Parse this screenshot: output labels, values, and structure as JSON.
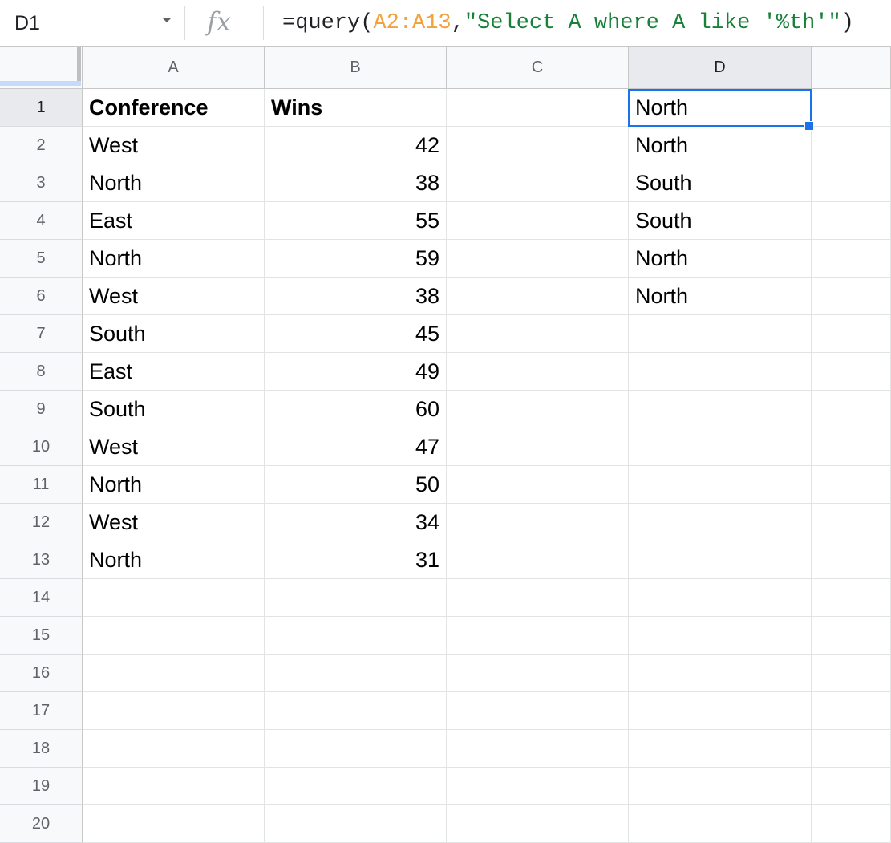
{
  "name_box": {
    "value": "D1"
  },
  "formula_bar": {
    "fx_label": "fx",
    "parts": [
      "=query(",
      "A2:A13",
      ",",
      "\"Select A where A like '%th'\"",
      ")"
    ]
  },
  "columns": [
    "A",
    "B",
    "C",
    "D"
  ],
  "selected_column": "D",
  "rows": [
    "1",
    "2",
    "3",
    "4",
    "5",
    "6",
    "7",
    "8",
    "9",
    "10",
    "11",
    "12",
    "13",
    "14",
    "15",
    "16",
    "17",
    "18",
    "19",
    "20"
  ],
  "selected_row": "1",
  "cells": {
    "A": [
      "Conference",
      "West",
      "North",
      "East",
      "North",
      "West",
      "South",
      "East",
      "South",
      "West",
      "North",
      "West",
      "North",
      "",
      "",
      "",
      "",
      "",
      "",
      ""
    ],
    "B": [
      "Wins",
      "42",
      "38",
      "55",
      "59",
      "38",
      "45",
      "49",
      "60",
      "47",
      "50",
      "34",
      "31",
      "",
      "",
      "",
      "",
      "",
      "",
      ""
    ],
    "C": [
      "",
      "",
      "",
      "",
      "",
      "",
      "",
      "",
      "",
      "",
      "",
      "",
      "",
      "",
      "",
      "",
      "",
      "",
      "",
      ""
    ],
    "D": [
      "North",
      "North",
      "South",
      "South",
      "North",
      "North",
      "",
      "",
      "",
      "",
      "",
      "",
      "",
      "",
      "",
      "",
      "",
      "",
      "",
      ""
    ]
  },
  "active_cell": "D1",
  "colors": {
    "selection": "#1a73e8",
    "range_highlight": "#f3a13a",
    "string_literal": "#188038"
  }
}
